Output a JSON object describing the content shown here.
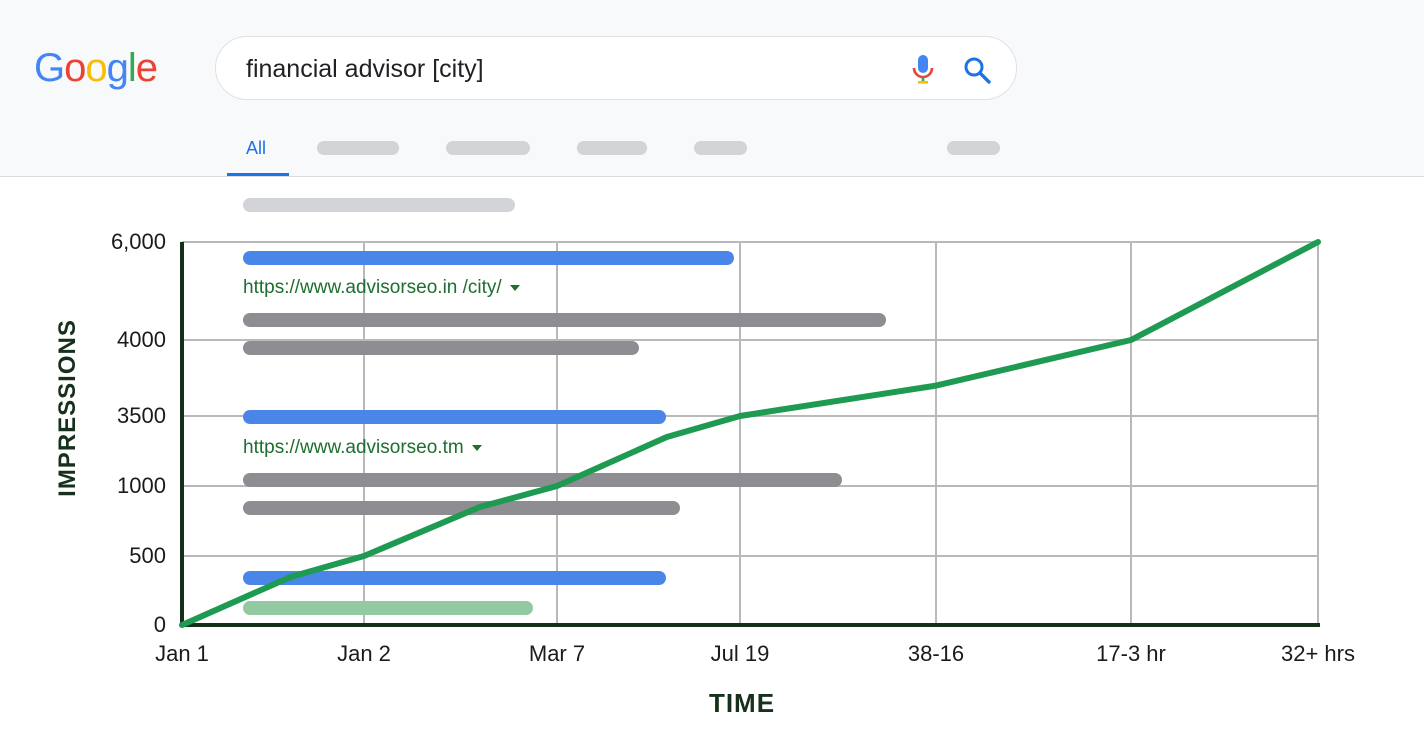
{
  "header": {
    "logo_letters": [
      {
        "char": "G",
        "color": "#4285F4"
      },
      {
        "char": "o",
        "color": "#EA4335"
      },
      {
        "char": "o",
        "color": "#FBBC05"
      },
      {
        "char": "g",
        "color": "#4285F4"
      },
      {
        "char": "l",
        "color": "#34A853"
      },
      {
        "char": "e",
        "color": "#EA4335"
      }
    ],
    "search_query": "financial advisor [city]",
    "mic_icon": "microphone-icon",
    "search_icon": "search-icon",
    "active_tab": "All"
  },
  "results": {
    "url_1": "https://www.advisorseo.in /city/",
    "url_2": "https://www.advisorseo.tm"
  },
  "colors": {
    "accent_blue": "#1a73e8",
    "result_title_blue": "#4a86e8",
    "snippet_gray": "#8e8e92",
    "line_green": "#1e9a52",
    "url_green": "#1e6e2f"
  },
  "chart_data": {
    "type": "line",
    "xlabel": "TIME",
    "ylabel": "IMPRESSIONS",
    "x_tick_labels": [
      "Jan 1",
      "Jan 2",
      "Mar 7",
      "Jul 19",
      "38-16",
      "17-3 hr",
      "32+ hrs"
    ],
    "y_tick_labels": [
      "0",
      "500",
      "1000",
      "3500",
      "4000",
      "6,000"
    ],
    "grid": true,
    "series": [
      {
        "values": [
          {
            "x": "Jan 1",
            "y": 0
          },
          {
            "x": "Jan 2",
            "y": 500
          },
          {
            "x": "Mar 7",
            "y": 1000
          },
          {
            "x": "Jul 19",
            "y": 3500
          },
          {
            "x": "38-16",
            "y": 3700
          },
          {
            "x": "17-3 hr",
            "y": 4000
          },
          {
            "x": "32+ hrs",
            "y": 6000
          }
        ]
      }
    ]
  }
}
